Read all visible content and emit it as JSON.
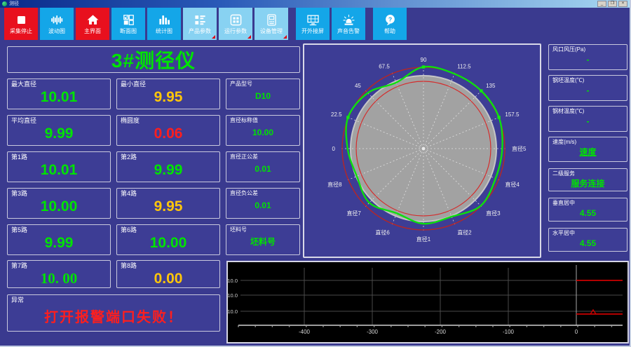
{
  "window": {
    "title": "测径",
    "controls": {
      "minimize": "_",
      "maximize": "❐",
      "close": "×"
    }
  },
  "toolbar": {
    "buttons": [
      {
        "id": "stop-collect",
        "label": "采集停止",
        "style": "red",
        "icon": "stop-icon"
      },
      {
        "id": "wave-chart",
        "label": "波动图",
        "style": "blue",
        "icon": "waveform-icon"
      },
      {
        "id": "main-screen",
        "label": "主界面",
        "style": "red",
        "icon": "home-icon"
      },
      {
        "id": "section-chart",
        "label": "断面图",
        "style": "blue",
        "icon": "section-icon"
      },
      {
        "id": "stats-chart",
        "label": "统计图",
        "style": "blue",
        "icon": "bar-chart-icon"
      },
      {
        "id": "product-params",
        "label": "产品参数",
        "style": "light",
        "icon": "product-params-icon",
        "corner": true
      },
      {
        "id": "run-params",
        "label": "运行参数",
        "style": "light",
        "icon": "run-params-icon",
        "corner": true
      },
      {
        "id": "device-manage",
        "label": "设备管理",
        "style": "light",
        "icon": "device-icon",
        "corner": true
      },
      {
        "id": "external-screen",
        "label": "开外接屏",
        "style": "blue",
        "icon": "monitor-icon",
        "gap": true
      },
      {
        "id": "sound-alarm",
        "label": "声音告警",
        "style": "blue",
        "icon": "alarm-icon"
      },
      {
        "id": "help",
        "label": "帮助",
        "style": "blue",
        "icon": "help-icon",
        "gap": true
      }
    ]
  },
  "gauge": {
    "title": "3#测径仪"
  },
  "cells": [
    {
      "id": "max-diameter",
      "label": "最大直径",
      "value": "10.01",
      "color": "g"
    },
    {
      "id": "min-diameter",
      "label": "最小直径",
      "value": "9.95",
      "color": "y"
    },
    {
      "id": "product-model",
      "label": "产品型号",
      "value": "D10",
      "color": "g",
      "size": "sm"
    },
    {
      "id": "avg-diameter",
      "label": "平均直径",
      "value": "9.99",
      "color": "g"
    },
    {
      "id": "ovality",
      "label": "椭圆度",
      "value": "0.06",
      "color": "r"
    },
    {
      "id": "nominal-diameter",
      "label": "直径标称值",
      "value": "10.00",
      "color": "g",
      "size": "sm"
    },
    {
      "id": "path-1",
      "label": "第1路",
      "value": "10.01",
      "color": "g"
    },
    {
      "id": "path-2",
      "label": "第2路",
      "value": "9.99",
      "color": "g"
    },
    {
      "id": "tolerance-plus",
      "label": "直径正公差",
      "value": "0.01",
      "color": "g",
      "size": "sm"
    },
    {
      "id": "path-3",
      "label": "第3路",
      "value": "10.00",
      "color": "g"
    },
    {
      "id": "path-4",
      "label": "第4路",
      "value": "9.95",
      "color": "y"
    },
    {
      "id": "tolerance-minus",
      "label": "直径负公差",
      "value": "0.01",
      "color": "g",
      "size": "sm"
    },
    {
      "id": "path-5",
      "label": "第5路",
      "value": "9.99",
      "color": "g"
    },
    {
      "id": "path-6",
      "label": "第6路",
      "value": "10.00",
      "color": "g"
    },
    {
      "id": "billet-no",
      "label": "坯料号",
      "value": "坯料号",
      "color": "g",
      "size": "sm"
    },
    {
      "id": "path-7",
      "label": "第7路",
      "value": "10. 00",
      "color": "g",
      "variant": "serif"
    },
    {
      "id": "path-8",
      "label": "第8路",
      "value": "0.00",
      "color": "y"
    },
    {
      "id": "abnormal",
      "label": "异常",
      "value": "打开报警端口失败！",
      "color": "r",
      "size": "alarm"
    }
  ],
  "right_cells": [
    {
      "id": "air-pressure",
      "label": "风口风压(Pa)",
      "value": "-",
      "color": "g"
    },
    {
      "id": "billet-temp",
      "label": "钢坯温度(℃)",
      "value": "-",
      "color": "g"
    },
    {
      "id": "steel-temp",
      "label": "钢材温度(℃)",
      "value": "-",
      "color": "g"
    },
    {
      "id": "speed",
      "label": "速度(m/s)",
      "value": "速度",
      "color": "g",
      "underline": true
    },
    {
      "id": "l2-service",
      "label": "二级服务",
      "value": "服务连接",
      "color": "g"
    },
    {
      "id": "vertical-center",
      "label": "垂直居中",
      "value": "4.55",
      "color": "g"
    },
    {
      "id": "horizontal-center",
      "label": "水平居中",
      "value": "4.55",
      "color": "g"
    }
  ],
  "chart_data": [
    {
      "type": "polar-profile",
      "title": "断面轮廓图",
      "nominal_radius_ratio": 1.0,
      "outer_tolerance_ratio": 1.115,
      "inner_tolerance_ratio": 0.923,
      "profile_ratios_from_0deg_ccw": [
        1.08,
        1.12,
        1.12,
        1.11,
        1.12,
        0.98,
        1.08,
        1.12,
        1.04,
        0.99,
        1.05,
        0.96,
        1.03,
        1.01,
        1.11,
        1.07
      ],
      "marker_degrees": [
        90,
        157.5,
        22.5,
        45
      ],
      "angle_labels": [
        {
          "text": "0",
          "deg": 180
        },
        {
          "text": "22.5",
          "deg": 157.5
        },
        {
          "text": "45",
          "deg": 135
        },
        {
          "text": "67.5",
          "deg": 112.5
        },
        {
          "text": "90",
          "deg": 90
        },
        {
          "text": "112.5",
          "deg": 67.5
        },
        {
          "text": "135",
          "deg": 45
        },
        {
          "text": "157.5",
          "deg": 22.5
        }
      ],
      "diameter_labels": [
        {
          "text": "直径1",
          "deg": 270
        },
        {
          "text": "直径2",
          "deg": 292.5
        },
        {
          "text": "直径3",
          "deg": 315
        },
        {
          "text": "直径4",
          "deg": 337.5
        },
        {
          "text": "直径5",
          "deg": 0
        },
        {
          "text": "直径6",
          "deg": 247.5
        },
        {
          "text": "直径7",
          "deg": 225
        },
        {
          "text": "直径8",
          "deg": 202.5
        }
      ],
      "colors": {
        "profile": "#0de00d",
        "tolerance": "#c42828",
        "nominal_fill": "#a2a2a2",
        "spokes": "#e8e8e8"
      }
    },
    {
      "type": "line",
      "title": "直径趋势",
      "x_tick_labels": [
        "-400",
        "-300",
        "-200",
        "-100",
        "0"
      ],
      "y_tick_labels": [
        "10.0",
        "10.0",
        "10.0"
      ],
      "series": [
        {
          "name": "upper-limit",
          "color": "#cc0000",
          "grid_row": 0,
          "x_start_label": "0"
        },
        {
          "name": "lower-limit",
          "color": "#cc0000",
          "grid_row": 2,
          "x_start_label": "0"
        }
      ],
      "grid": true,
      "background": "#000000"
    }
  ]
}
